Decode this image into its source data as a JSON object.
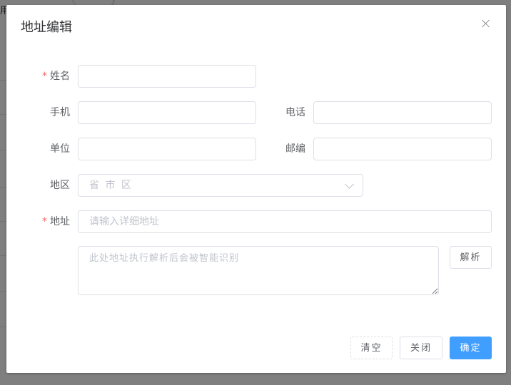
{
  "background": {
    "partial_text": "用"
  },
  "dialog": {
    "title": "地址编辑",
    "close_icon": "close-icon"
  },
  "form": {
    "name": {
      "label": "姓名",
      "required": true,
      "value": "",
      "placeholder": ""
    },
    "mobile": {
      "label": "手机",
      "value": "",
      "placeholder": ""
    },
    "phone": {
      "label": "电话",
      "value": "",
      "placeholder": ""
    },
    "company": {
      "label": "单位",
      "value": "",
      "placeholder": ""
    },
    "postcode": {
      "label": "邮编",
      "value": "",
      "placeholder": ""
    },
    "region": {
      "label": "地区",
      "placeholder": "省 市 区",
      "icon": "chevron-down-icon"
    },
    "address": {
      "label": "地址",
      "required": true,
      "value": "",
      "placeholder": "请输入详细地址"
    },
    "parse_area": {
      "value": "",
      "placeholder": "此处地址执行解析后会被智能识别"
    },
    "required_mark": "*"
  },
  "buttons": {
    "parse": "解析",
    "clear": "清空",
    "close": "关闭",
    "confirm": "确定"
  },
  "colors": {
    "primary": "#409eff",
    "required": "#f56c6c",
    "border": "#dcdfe6",
    "placeholder": "#c0c4cc"
  }
}
